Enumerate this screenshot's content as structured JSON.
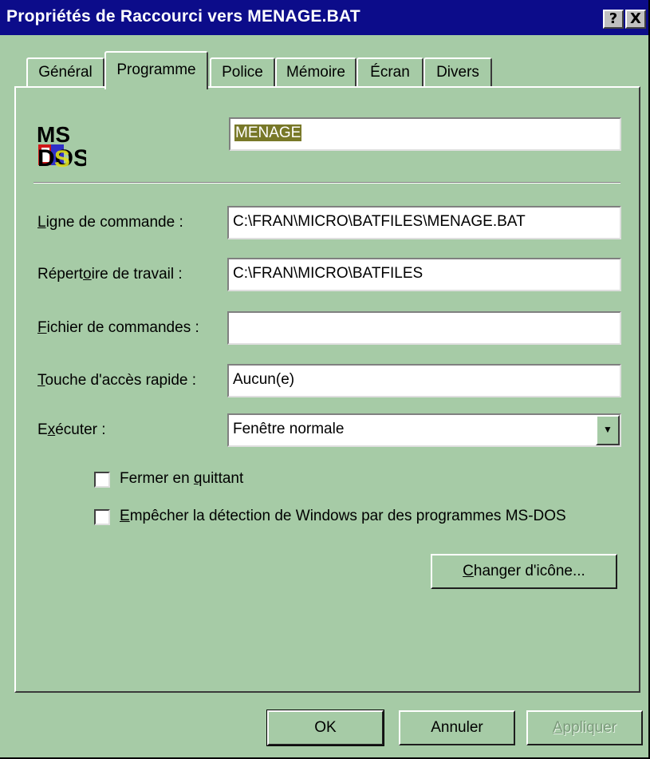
{
  "window": {
    "title": "Propriétés de Raccourci vers MENAGE.BAT"
  },
  "titlebar_buttons": {
    "help": "?",
    "close": "X"
  },
  "tabs": [
    {
      "label": "Général"
    },
    {
      "label": "Programme",
      "active": true
    },
    {
      "label": "Police"
    },
    {
      "label": "Mémoire"
    },
    {
      "label": "Écran"
    },
    {
      "label": "Divers"
    }
  ],
  "program": {
    "icon": "ms-dos-icon",
    "name_value": "MENAGE",
    "command_line": {
      "label_u": "L",
      "label_rest": "igne de commande :",
      "value": "C:\\FRAN\\MICRO\\BATFILES\\MENAGE.BAT"
    },
    "working_dir": {
      "label_a": "Répert",
      "label_u": "o",
      "label_b": "ire de travail :",
      "value": "C:\\FRAN\\MICRO\\BATFILES"
    },
    "batch_file": {
      "label_u": "F",
      "label_rest": "ichier de commandes :",
      "value": ""
    },
    "shortcut_key": {
      "label_u": "T",
      "label_rest": "ouche d'accès rapide :",
      "value": "Aucun(e)"
    },
    "run": {
      "label_a": "E",
      "label_u": "x",
      "label_b": "écuter :",
      "value": "Fenêtre normale"
    },
    "close_on_exit": {
      "label_a": "Fermer en ",
      "label_u": "q",
      "label_b": "uittant",
      "checked": false
    },
    "prevent_detect": {
      "label_u": "E",
      "label_rest": "mpêcher la détection de Windows par des programmes MS-DOS",
      "checked": false
    },
    "change_icon": {
      "label_u": "C",
      "label_rest": "hanger d'icône..."
    }
  },
  "footer": {
    "ok": "OK",
    "cancel": "Annuler",
    "apply_u": "A",
    "apply_rest": "ppliquer"
  },
  "colors": {
    "face": "#a6cba6",
    "titlebar": "#0c0c8a",
    "selection": "#787828"
  }
}
